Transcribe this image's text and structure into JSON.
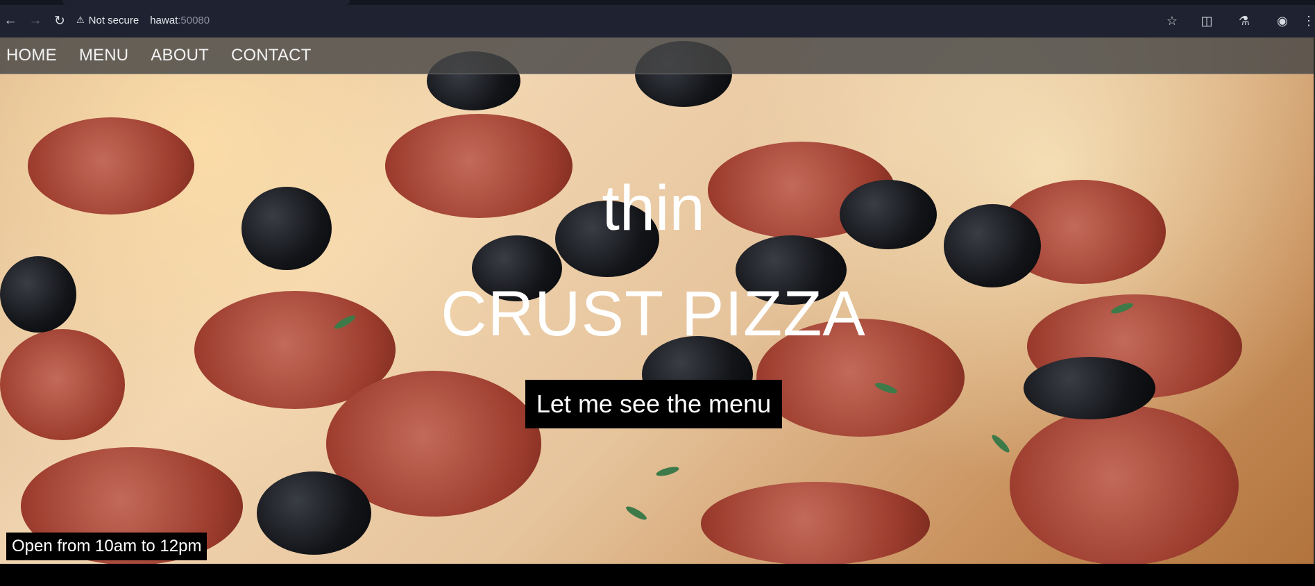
{
  "browser": {
    "security_label": "Not secure",
    "url_host": "hawat",
    "url_port": ":50080",
    "icons": {
      "back": "arrow-left-icon",
      "forward": "arrow-right-icon",
      "reload": "reload-icon",
      "warning": "warning-triangle-icon",
      "bookmark": "star-icon",
      "extensions": "puzzle-icon",
      "labs": "flask-icon",
      "profile": "profile-icon",
      "menu": "kebab-menu-icon"
    }
  },
  "site": {
    "nav": [
      "HOME",
      "MENU",
      "ABOUT",
      "CONTACT"
    ],
    "hero": {
      "title_top": "thin",
      "title_main": "CRUST PIZZA",
      "cta_label": "Let me see the menu"
    },
    "hours": "Open from 10am to 12pm"
  },
  "colors": {
    "browser_bar": "#1f2230",
    "nav_bar": "#464646",
    "cta_bg": "#000000",
    "text": "#ffffff"
  }
}
